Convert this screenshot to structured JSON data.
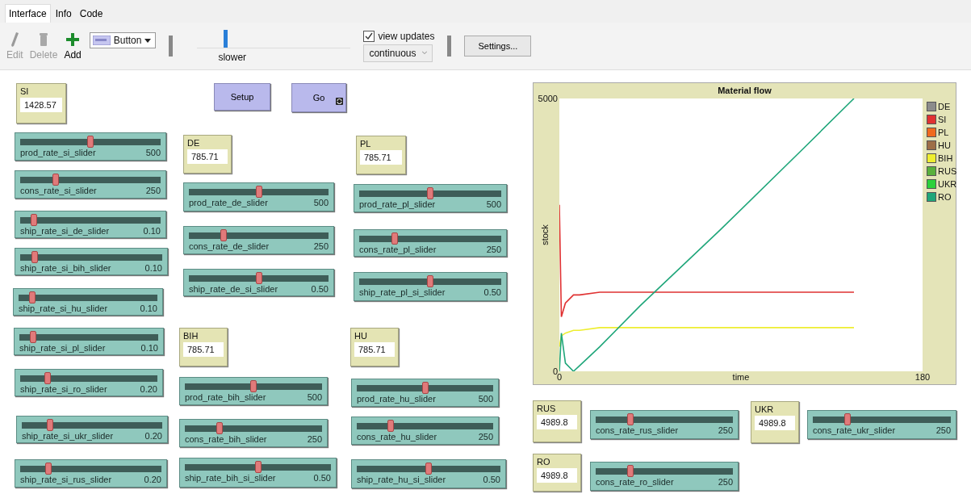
{
  "tabs": [
    {
      "label": "Interface",
      "selected": true
    },
    {
      "label": "Info",
      "selected": false
    },
    {
      "label": "Code",
      "selected": false
    }
  ],
  "toolbar": {
    "tools": [
      {
        "kind": "edit",
        "label": "Edit",
        "disabled": true
      },
      {
        "kind": "delete",
        "label": "Delete",
        "disabled": true
      },
      {
        "kind": "add",
        "label": "Add",
        "disabled": false
      }
    ],
    "widget_type": "Button",
    "speed": {
      "label": "slower",
      "level": 0.17
    },
    "view_updates": {
      "label": "view updates",
      "checked": true
    },
    "update_mode": "continuous",
    "settings": "Settings..."
  },
  "widgets": [
    {
      "kind": "monitor",
      "label": "SI",
      "value": "1428.57"
    },
    {
      "kind": "button",
      "label": "Setup",
      "forever": false
    },
    {
      "kind": "button",
      "label": "Go",
      "forever": true
    },
    {
      "kind": "plot",
      "chart_data": {
        "type": "line",
        "title": "Material flow",
        "xlabel": "time",
        "ylabel": "stock",
        "xlim": [
          0,
          180
        ],
        "ylim": [
          0,
          5000
        ],
        "xticks": [
          0,
          180
        ],
        "yticks": [
          0,
          5000
        ],
        "legend": true,
        "x": [
          0,
          1,
          3,
          7,
          10,
          20,
          40,
          80,
          120,
          146
        ],
        "series": [
          {
            "name": "DE",
            "color": "#8c8c8c",
            "values": [
              null,
              null,
              null,
              null,
              null,
              null,
              null,
              null,
              null,
              null
            ]
          },
          {
            "name": "SI",
            "color": "#e03232",
            "values": [
              3050,
              1000,
              1250,
              1400,
              1400,
              1450,
              1450,
              1450,
              1450,
              1450
            ]
          },
          {
            "name": "PL",
            "color": "#f06a1e",
            "values": [
              null,
              null,
              null,
              null,
              null,
              null,
              null,
              null,
              null,
              null
            ]
          },
          {
            "name": "HU",
            "color": "#9d6e48",
            "values": [
              null,
              null,
              null,
              null,
              null,
              null,
              null,
              null,
              null,
              null
            ]
          },
          {
            "name": "BIH",
            "color": "#eeee30",
            "values": [
              450,
              650,
              700,
              750,
              750,
              800,
              800,
              800,
              800,
              800
            ]
          },
          {
            "name": "RUS",
            "color": "#59b03c",
            "values": [
              null,
              null,
              null,
              null,
              null,
              null,
              null,
              null,
              null,
              null
            ]
          },
          {
            "name": "UKR",
            "color": "#2cd13b",
            "values": [
              null,
              null,
              null,
              null,
              null,
              null,
              null,
              null,
              null,
              null
            ]
          },
          {
            "name": "RO",
            "color": "#1fa67a",
            "values": [
              0,
              700,
              150,
              0,
              100,
              450,
              1200,
              2600,
              4050,
              5000
            ]
          }
        ]
      }
    },
    {
      "kind": "slider",
      "label": "prod_rate_si_slider",
      "value": "500",
      "level": 0.5
    },
    {
      "kind": "slider",
      "label": "cons_rate_si_slider",
      "value": "250",
      "level": 0.25
    },
    {
      "kind": "slider",
      "label": "ship_rate_si_de_slider",
      "value": "0.10",
      "level": 0.1
    },
    {
      "kind": "slider",
      "label": "ship_rate_si_bih_slider",
      "value": "0.10",
      "level": 0.1
    },
    {
      "kind": "slider",
      "label": "ship_rate_si_hu_slider",
      "value": "0.10",
      "level": 0.1
    },
    {
      "kind": "slider",
      "label": "ship_rate_si_pl_slider",
      "value": "0.10",
      "level": 0.1
    },
    {
      "kind": "slider",
      "label": "ship_rate_si_ro_slider",
      "value": "0.20",
      "level": 0.2
    },
    {
      "kind": "slider",
      "label": "ship_rate_si_ukr_slider",
      "value": "0.20",
      "level": 0.2
    },
    {
      "kind": "slider",
      "label": "ship_rate_si_rus_slider",
      "value": "0.20",
      "level": 0.2
    },
    {
      "kind": "monitor",
      "label": "DE",
      "value": "785.71"
    },
    {
      "kind": "slider",
      "label": "prod_rate_de_slider",
      "value": "500",
      "level": 0.5
    },
    {
      "kind": "slider",
      "label": "cons_rate_de_slider",
      "value": "250",
      "level": 0.25
    },
    {
      "kind": "slider",
      "label": "ship_rate_de_si_slider",
      "value": "0.50",
      "level": 0.5
    },
    {
      "kind": "monitor",
      "label": "PL",
      "value": "785.71"
    },
    {
      "kind": "slider",
      "label": "prod_rate_pl_slider",
      "value": "500",
      "level": 0.5
    },
    {
      "kind": "slider",
      "label": "cons_rate_pl_slider",
      "value": "250",
      "level": 0.25
    },
    {
      "kind": "slider",
      "label": "ship_rate_pl_si_slider",
      "value": "0.50",
      "level": 0.5
    },
    {
      "kind": "monitor",
      "label": "BIH",
      "value": "785.71"
    },
    {
      "kind": "slider",
      "label": "prod_rate_bih_slider",
      "value": "500",
      "level": 0.5
    },
    {
      "kind": "slider",
      "label": "cons_rate_bih_slider",
      "value": "250",
      "level": 0.25
    },
    {
      "kind": "slider",
      "label": "ship_rate_bih_si_slider",
      "value": "0.50",
      "level": 0.5
    },
    {
      "kind": "monitor",
      "label": "HU",
      "value": "785.71"
    },
    {
      "kind": "slider",
      "label": "prod_rate_hu_slider",
      "value": "500",
      "level": 0.5
    },
    {
      "kind": "slider",
      "label": "cons_rate_hu_slider",
      "value": "250",
      "level": 0.25
    },
    {
      "kind": "slider",
      "label": "ship_rate_hu_si_slider",
      "value": "0.50",
      "level": 0.5
    },
    {
      "kind": "monitor",
      "label": "RUS",
      "value": "4989.8"
    },
    {
      "kind": "slider",
      "label": "cons_rate_rus_slider",
      "value": "250",
      "level": 0.25
    },
    {
      "kind": "monitor",
      "label": "UKR",
      "value": "4989.8"
    },
    {
      "kind": "slider",
      "label": "cons_rate_ukr_slider",
      "value": "250",
      "level": 0.25
    },
    {
      "kind": "monitor",
      "label": "RO",
      "value": "4989.8"
    },
    {
      "kind": "slider",
      "label": "cons_rate_ro_slider",
      "value": "250",
      "level": 0.25
    }
  ]
}
